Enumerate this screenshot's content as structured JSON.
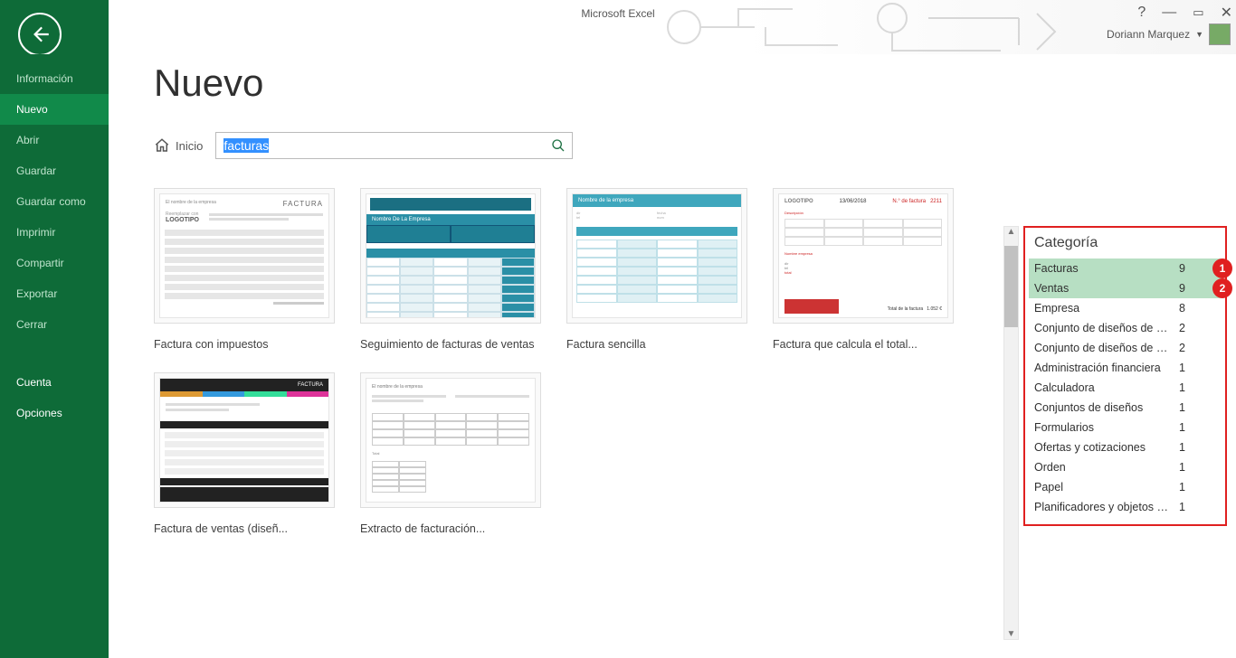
{
  "app_title": "Microsoft Excel",
  "user_name": "Doriann Marquez",
  "sidebar": {
    "items": [
      {
        "label": "Información",
        "id": "info"
      },
      {
        "label": "Nuevo",
        "id": "new",
        "active": true
      },
      {
        "label": "Abrir",
        "id": "open"
      },
      {
        "label": "Guardar",
        "id": "save"
      },
      {
        "label": "Guardar como",
        "id": "saveas"
      },
      {
        "label": "Imprimir",
        "id": "print"
      },
      {
        "label": "Compartir",
        "id": "share"
      },
      {
        "label": "Exportar",
        "id": "export"
      },
      {
        "label": "Cerrar",
        "id": "close"
      }
    ],
    "bottom_items": [
      {
        "label": "Cuenta",
        "id": "account"
      },
      {
        "label": "Opciones",
        "id": "options"
      }
    ]
  },
  "page": {
    "title": "Nuevo",
    "home_label": "Inicio",
    "search_value": "facturas"
  },
  "templates": [
    {
      "caption": "Factura con impuestos",
      "variant": "invoice1"
    },
    {
      "caption": "Seguimiento de facturas de ventas",
      "variant": "invoice2"
    },
    {
      "caption": "Factura sencilla",
      "variant": "invoice3"
    },
    {
      "caption": "Factura que calcula el total...",
      "variant": "invoice4"
    },
    {
      "caption": "Factura de ventas (diseñ...",
      "variant": "invoice5"
    },
    {
      "caption": "Extracto de facturación...",
      "variant": "invoice6"
    }
  ],
  "category_panel": {
    "title": "Categoría",
    "items": [
      {
        "name": "Facturas",
        "count": 9,
        "selected": true,
        "badge": "1"
      },
      {
        "name": "Ventas",
        "count": 9,
        "selected": true,
        "badge": "2"
      },
      {
        "name": "Empresa",
        "count": 8
      },
      {
        "name": "Conjunto de diseños de deg...",
        "count": 2
      },
      {
        "name": "Conjunto de diseños de deg...",
        "count": 2
      },
      {
        "name": "Administración financiera",
        "count": 1
      },
      {
        "name": "Calculadora",
        "count": 1
      },
      {
        "name": "Conjuntos de diseños",
        "count": 1
      },
      {
        "name": "Formularios",
        "count": 1
      },
      {
        "name": "Ofertas y cotizaciones",
        "count": 1
      },
      {
        "name": "Orden",
        "count": 1
      },
      {
        "name": "Papel",
        "count": 1
      },
      {
        "name": "Planificadores y objetos de...",
        "count": 1
      }
    ]
  }
}
